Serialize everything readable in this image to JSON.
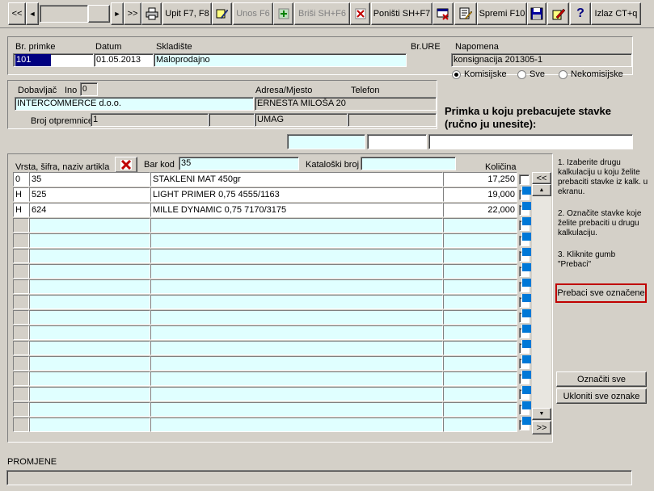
{
  "toolbar": {
    "nav_first": "<<",
    "nav_prev": "◄",
    "nav_next": "►",
    "nav_last": ">>",
    "upit": "Upit F7, F8",
    "unos": "Unos F6",
    "brisi": "Briši  SH+F6",
    "ponisti": "Poništi SH+F7",
    "spremi": "Spremi F10",
    "help": "?",
    "izlaz": "Izlaz CT+q"
  },
  "header": {
    "br_primke_label": "Br. primke",
    "br_primke": "101",
    "datum_label": "Datum",
    "datum": "01.05.2013",
    "skladiste_label": "Skladište",
    "skladiste": "Maloprodajno",
    "br_ure_label": "Br.URE",
    "napomena_label": "Napomena",
    "napomena": "konsignacija 201305-1",
    "radio": [
      "Komisijske",
      "Sve",
      "Nekomisijske"
    ],
    "radio_selected": 0
  },
  "supplier": {
    "dobavljac_label": "Dobavljač",
    "ino_label": "Ino",
    "ino_value": "0",
    "dobavljac": "INTERCOMMERCE d.o.o.",
    "adresa_label": "Adresa/Mjesto",
    "telefon_label": "Telefon",
    "adresa": "ERNESTA MILOŠA 20",
    "mjesto": "UMAG",
    "broj_otpremnice_label": "Broj otpremnice",
    "broj_otpremnice": "1"
  },
  "transfer": {
    "title_line1": "Primka u koju prebacujete stavke",
    "title_line2": "(ručno ju unesite):"
  },
  "grid": {
    "col_artikl_label": "Vrsta, šifra, naziv artikla",
    "barkod_label": "Bar kod",
    "barkod_value": "35",
    "katalog_label": "Kataloški broj",
    "kolicina_label": "Količina",
    "rows": [
      {
        "vrsta": "0",
        "sifra": "35",
        "naziv": "STAKLENI MAT 450gr",
        "kolicina": "17,250"
      },
      {
        "vrsta": "H",
        "sifra": "525",
        "naziv": "LIGHT PRIMER 0,75  4555/1163",
        "kolicina": "19,000"
      },
      {
        "vrsta": "H",
        "sifra": "624",
        "naziv": "MILLE DYNAMIC 0,75 7170/3175",
        "kolicina": "22,000"
      }
    ],
    "scroll_up_label": "<<",
    "scroll_down_label": ">>"
  },
  "instructions": {
    "step1": "1. Izaberite drugu kalkulaciju u koju želite prebaciti stavke iz kalk. u ekranu.",
    "step2": "2. Označite stavke koje želite prebaciti u drugu kalkulaciju.",
    "step3": "3. Kliknite gumb \"Prebaci\""
  },
  "actions": {
    "prebaci": "Prebaci sve označene",
    "oznaciti": "Označiti sve",
    "ukloniti": "Ukloniti sve oznake"
  },
  "footer": {
    "promjene_label": "PROMJENE"
  }
}
